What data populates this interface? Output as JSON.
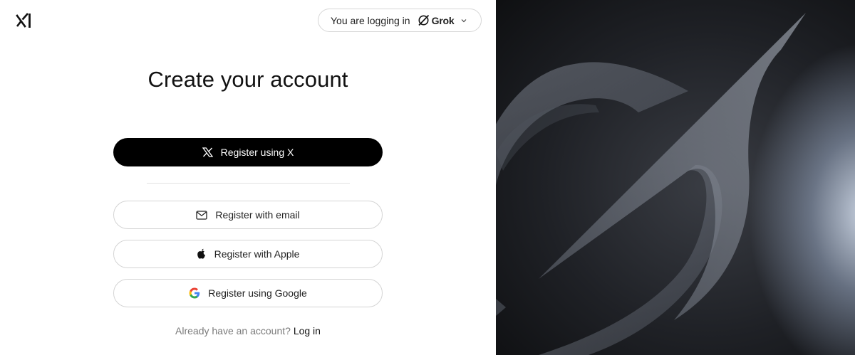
{
  "header": {
    "logo_icon": "xai-logo-icon",
    "login_context_prefix": "You are logging in",
    "product_name": "Grok",
    "product_icon": "grok-icon",
    "dropdown_icon": "chevron-down-icon"
  },
  "main": {
    "title": "Create your account",
    "buttons": {
      "register_x": "Register using X",
      "register_email": "Register with email",
      "register_apple": "Register with Apple",
      "register_google": "Register using Google"
    },
    "footer_prompt": "Already have an account?",
    "footer_link": "Log in"
  },
  "colors": {
    "primary_button_bg": "#000000",
    "primary_button_text": "#ffffff",
    "outline_border": "#d4d4d4",
    "muted_text": "#7a7a7a"
  },
  "hero": {
    "image_icon": "grok-hero-graphic"
  }
}
